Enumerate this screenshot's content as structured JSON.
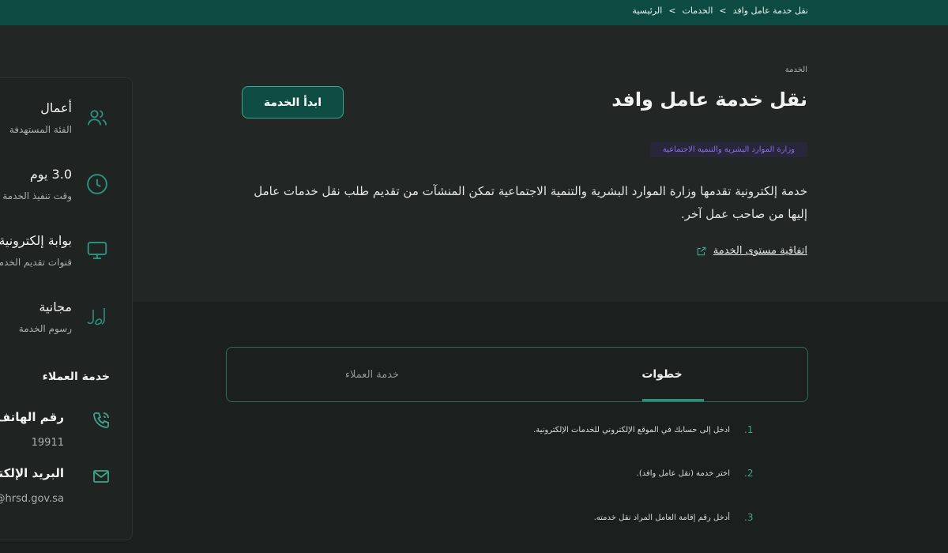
{
  "breadcrumb": {
    "home": "الرئيسية",
    "sep1": ">",
    "services": "الخدمات",
    "sep2": ">",
    "current": "نقل خدمة عامل وافد"
  },
  "service": {
    "kicker": "الخدمة",
    "title": "نقل خدمة عامل وافد",
    "start_label": "ابدأ الخدمة",
    "ministry": "وزارة الموارد البشرية والتنمية الاجتماعية",
    "description": "خدمة إلكترونية تقدمها وزارة الموارد البشرية والتنمية الاجتماعية تمكن المنشآت من تقديم طلب نقل خدمات عامل إليها من صاحب عمل آخر.",
    "sla_label": "اتفاقية مستوى الخدمة"
  },
  "sidebar": {
    "items": [
      {
        "value": "أعمال",
        "label": "الفئة المستهدفة",
        "icon": "users-icon"
      },
      {
        "value": "3.0 يوم",
        "label": "وقت تنفيذ الخدمة",
        "icon": "clock-icon"
      },
      {
        "value": "بوابة إلكترونية",
        "label": "قنوات تقديم الخدمة",
        "icon": "monitor-icon"
      },
      {
        "value": "مجانية",
        "label": "رسوم الخدمة",
        "icon": "riyal-icon"
      }
    ],
    "customer_service_title": "خدمة العملاء",
    "phone": {
      "label": "رقم الهاتف",
      "value": "19911",
      "icon": "phone-icon"
    },
    "email": {
      "label": "البريد الإلكتروني",
      "value": "@hrsd.gov.sa",
      "icon": "mail-icon"
    }
  },
  "tabs": {
    "steps": "خطوات",
    "customer_service": "خدمة العملاء"
  },
  "steps": [
    {
      "num": ".1",
      "text": "ادخل إلى حسابك في الموقع الإلكتروني للخدمات الإلكترونية."
    },
    {
      "num": ".2",
      "text": "اختر خدمة (نقل عامل وافد)."
    },
    {
      "num": ".3",
      "text": "أدخل رقم إقامة العامل المراد نقل خدمته."
    }
  ],
  "colors": {
    "topbar": "#0c4a42",
    "accent": "#2f8f7b",
    "ministry_badge_text": "#8b6fe0",
    "background": "#1b1f1e"
  }
}
